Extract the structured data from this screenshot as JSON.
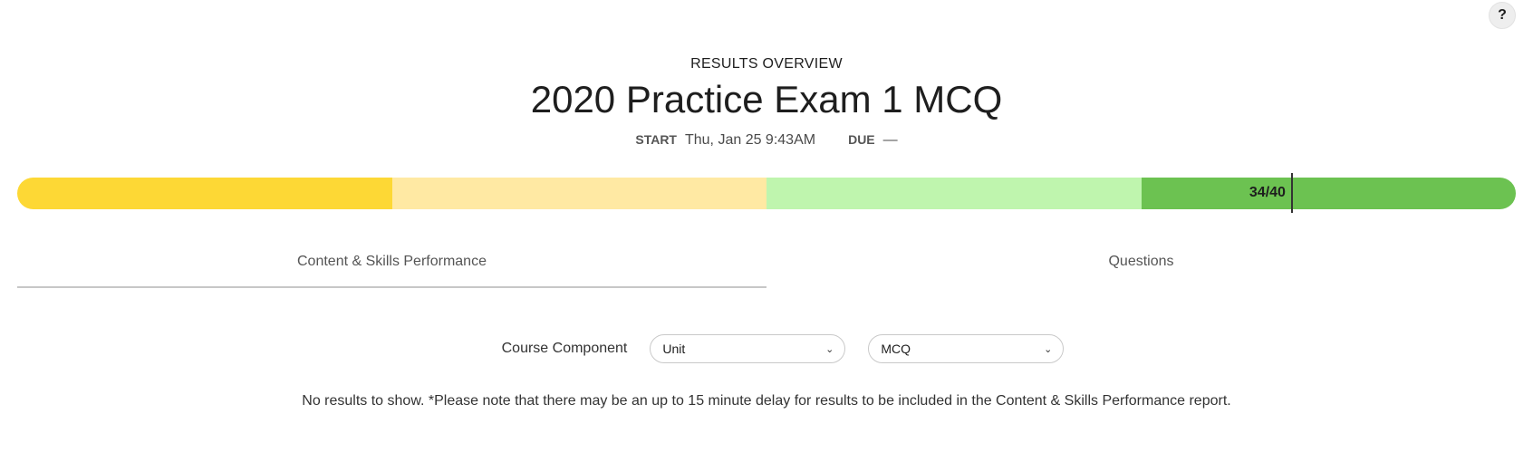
{
  "help": {
    "label": "?"
  },
  "header": {
    "eyebrow": "RESULTS OVERVIEW",
    "title": "2020 Practice Exam 1 MCQ",
    "start_label": "START",
    "start_value": "Thu, Jan 25 9:43AM",
    "due_label": "DUE",
    "due_value": "—"
  },
  "score": {
    "label": "34/40",
    "correct": 34,
    "total": 40,
    "segment_colors": [
      "#fdd835",
      "#ffe9a3",
      "#bff5ae",
      "#6cc251"
    ]
  },
  "tabs": [
    {
      "label": "Content & Skills Performance",
      "active": true
    },
    {
      "label": "Questions",
      "active": false
    }
  ],
  "filters": {
    "label": "Course Component",
    "selects": [
      {
        "value": "Unit"
      },
      {
        "value": "MCQ"
      }
    ]
  },
  "notice": "No results to show. *Please note that there may be an up to 15 minute delay for results to be included in the Content & Skills Performance report."
}
